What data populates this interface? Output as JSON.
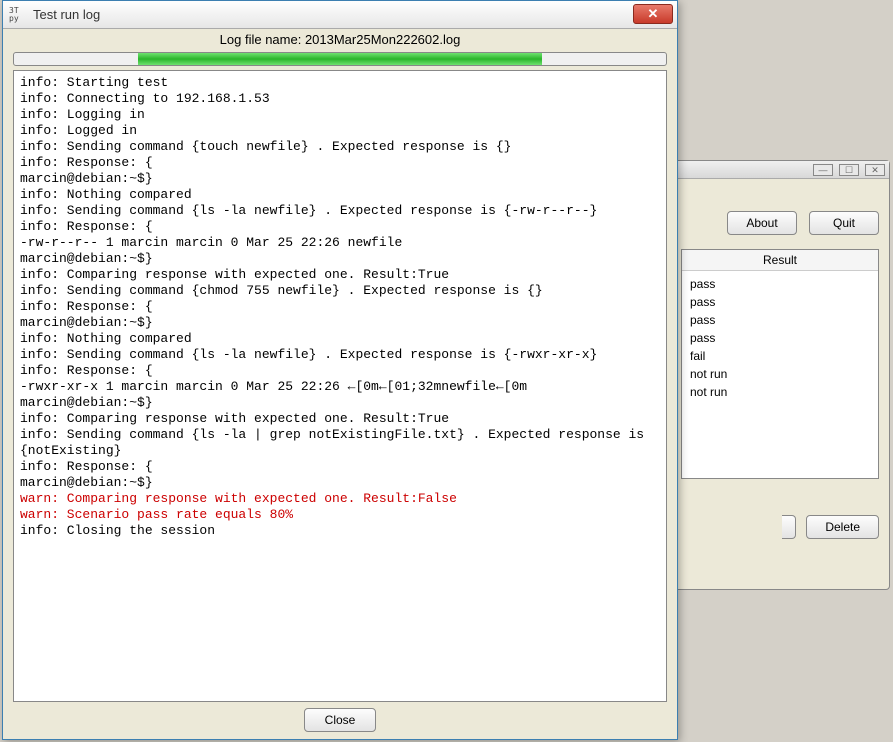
{
  "bg_window": {
    "about_label": "About",
    "quit_label": "Quit",
    "delete_label": "Delete",
    "result_header": "Result",
    "control_min": "—",
    "control_max": "☐",
    "control_close": "✕",
    "results": [
      "pass",
      "pass",
      "pass",
      "pass",
      "fail",
      "not run",
      "not run"
    ]
  },
  "log_window": {
    "app_icon_top": "3T",
    "app_icon_bottom": "py",
    "title": "Test run log",
    "close_glyph": "✕",
    "header_label": "Log file name: ",
    "log_filename": "2013Mar25Mon222602.log",
    "close_label": "Close",
    "lines": [
      {
        "t": "info: Starting test",
        "c": "info"
      },
      {
        "t": "info: Connecting to 192.168.1.53",
        "c": "info"
      },
      {
        "t": "info: Logging in",
        "c": "info"
      },
      {
        "t": "info: Logged in",
        "c": "info"
      },
      {
        "t": "info: Sending command {touch newfile} . Expected response is {}",
        "c": "info"
      },
      {
        "t": "info: Response: {",
        "c": "info"
      },
      {
        "t": "marcin@debian:~$}",
        "c": "info"
      },
      {
        "t": "info: Nothing compared",
        "c": "info"
      },
      {
        "t": "info: Sending command {ls -la newfile} . Expected response is {-rw-r--r--}",
        "c": "info"
      },
      {
        "t": "info: Response: {",
        "c": "info"
      },
      {
        "t": "-rw-r--r-- 1 marcin marcin 0 Mar 25 22:26 newfile",
        "c": "info"
      },
      {
        "t": "marcin@debian:~$}",
        "c": "info"
      },
      {
        "t": "info: Comparing response with expected one. Result:True",
        "c": "info"
      },
      {
        "t": "info: Sending command {chmod 755 newfile} . Expected response is {}",
        "c": "info"
      },
      {
        "t": "info: Response: {",
        "c": "info"
      },
      {
        "t": "marcin@debian:~$}",
        "c": "info"
      },
      {
        "t": "info: Nothing compared",
        "c": "info"
      },
      {
        "t": "info: Sending command {ls -la newfile} . Expected response is {-rwxr-xr-x}",
        "c": "info"
      },
      {
        "t": "info: Response: {",
        "c": "info"
      },
      {
        "t": "-rwxr-xr-x 1 marcin marcin 0 Mar 25 22:26 ←[0m←[01;32mnewfile←[0m",
        "c": "info"
      },
      {
        "t": "marcin@debian:~$}",
        "c": "info"
      },
      {
        "t": "info: Comparing response with expected one. Result:True",
        "c": "info"
      },
      {
        "t": "info: Sending command {ls -la | grep notExistingFile.txt} . Expected response is {notExisting}",
        "c": "info"
      },
      {
        "t": "info: Response: {",
        "c": "info"
      },
      {
        "t": "marcin@debian:~$}",
        "c": "info"
      },
      {
        "t": "warn: Comparing response with expected one. Result:False",
        "c": "warn"
      },
      {
        "t": "warn: Scenario pass rate equals 80%",
        "c": "warn"
      },
      {
        "t": "info: Closing the session",
        "c": "info"
      }
    ]
  }
}
